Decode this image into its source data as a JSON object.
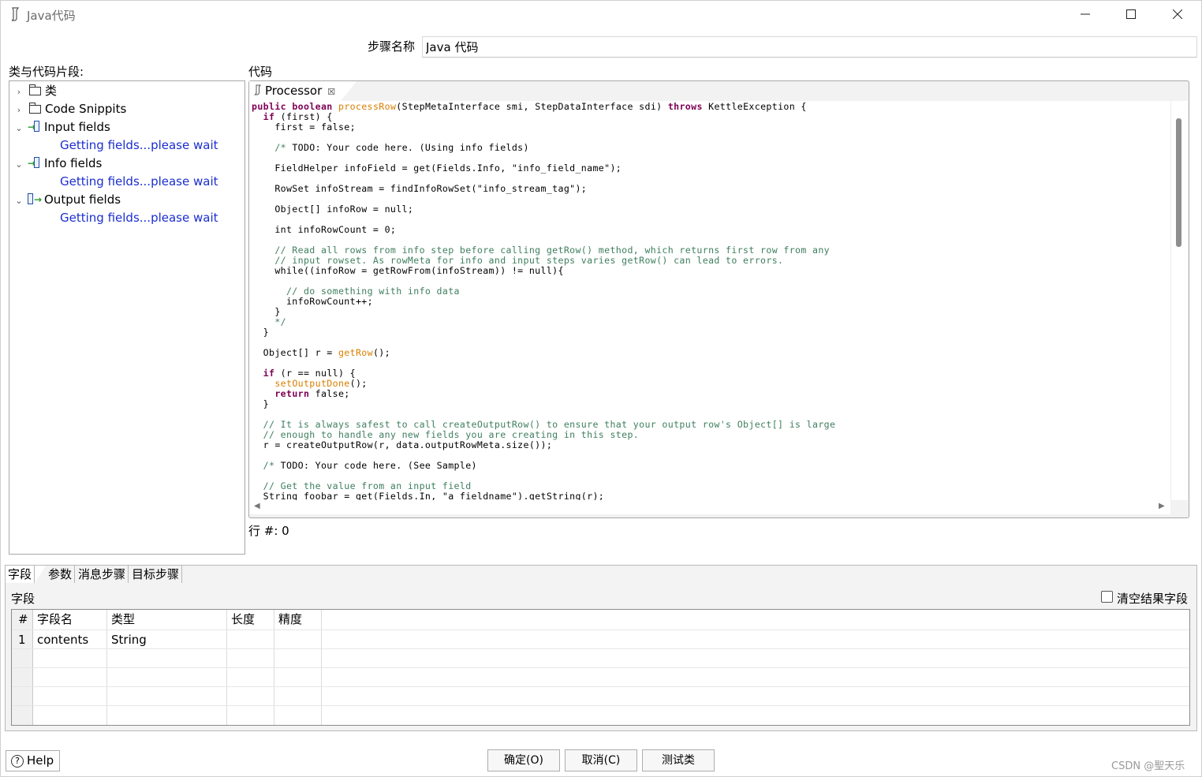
{
  "window": {
    "title": "Java代码",
    "minimize": "—",
    "maximize": "☐",
    "close": "✕"
  },
  "step_name": {
    "label": "步骤名称",
    "value": "Java 代码"
  },
  "tree": {
    "label": "类与代码片段:",
    "items": [
      {
        "label": "类",
        "expanded": false
      },
      {
        "label": "Code Snippits",
        "expanded": false
      },
      {
        "label": "Input fields",
        "expanded": true,
        "child": "Getting fields...please wait"
      },
      {
        "label": "Info fields",
        "expanded": true,
        "child": "Getting fields...please wait"
      },
      {
        "label": "Output fields",
        "expanded": true,
        "child": "Getting fields...please wait"
      }
    ]
  },
  "code": {
    "label": "代码",
    "tab": "Processor",
    "lines": [
      "public boolean processRow(StepMetaInterface smi, StepDataInterface sdi) throws KettleException {",
      "  if (first) {",
      "    first = false;",
      "",
      "    /* TODO: Your code here. (Using info fields)",
      "",
      "    FieldHelper infoField = get(Fields.Info, \"info_field_name\");",
      "",
      "    RowSet infoStream = findInfoRowSet(\"info_stream_tag\");",
      "",
      "    Object[] infoRow = null;",
      "",
      "    int infoRowCount = 0;",
      "",
      "    // Read all rows from info step before calling getRow() method, which returns first row from any",
      "    // input rowset. As rowMeta for info and input steps varies getRow() can lead to errors.",
      "    while((infoRow = getRowFrom(infoStream)) != null){",
      "",
      "      // do something with info data",
      "      infoRowCount++;",
      "    }",
      "    */",
      "  }",
      "",
      "  Object[] r = getRow();",
      "",
      "  if (r == null) {",
      "    setOutputDone();",
      "    return false;",
      "  }",
      "",
      "  // It is always safest to call createOutputRow() to ensure that your output row's Object[] is large",
      "  // enough to handle any new fields you are creating in this step.",
      "  r = createOutputRow(r, data.outputRowMeta.size());",
      "",
      "  /* TODO: Your code here. (See Sample)",
      "",
      "  // Get the value from an input field",
      "  String foobar = get(Fields.In, \"a_fieldname\").getString(r);"
    ],
    "row_indicator": "行 #: 0"
  },
  "bottom_tabs": [
    "字段",
    "参数",
    "消息步骤",
    "目标步骤"
  ],
  "fields_panel": {
    "label": "字段",
    "clear_result_label": "清空结果字段",
    "clear_result_checked": false,
    "columns": [
      "#",
      "字段名",
      "类型",
      "长度",
      "精度"
    ],
    "rows": [
      [
        "1",
        "contents",
        "String",
        "",
        ""
      ]
    ]
  },
  "footer": {
    "help": "Help",
    "ok": "确定(O)",
    "cancel": "取消(C)",
    "test": "测试类"
  },
  "watermark": "CSDN @聖天乐"
}
